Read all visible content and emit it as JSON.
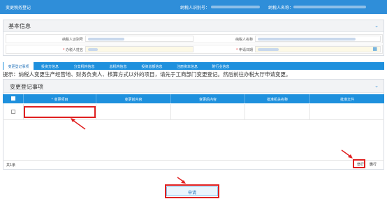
{
  "topbar": {
    "title": "变更税务登记",
    "taxpayer_id_label": "纳税人识别号：",
    "taxpayer_name_label": "纳税人名称："
  },
  "basic_info": {
    "title": "基本信息",
    "fields": {
      "taxpayer_id_label": "纳税人识别号",
      "taxpayer_name_label": "纳税人名称",
      "handler_name_label": "办税人姓名",
      "apply_date_label": "申请日期"
    }
  },
  "tabs": [
    "变更登记事项",
    "投资方信息",
    "分支机构信息",
    "总机构信息",
    "投资总额信息",
    "注册资本信息",
    "附行业信息"
  ],
  "hint": "提示：纳税人变更生产经营地、财务负责人、核算方式以外的项目，请先于工商部门变更登记。然后前往办税大厅申请变更。",
  "change_section": {
    "title": "变更登记事项",
    "columns": [
      "变更项目",
      "变更前内容",
      "变更后内容",
      "批准机关名称",
      "批准文件"
    ],
    "total": "共1条",
    "add_row": "增行",
    "delete_row": "删行"
  },
  "submit_label": "申请",
  "colors": {
    "accent": "#1e90dd",
    "annotation": "#e02020"
  }
}
